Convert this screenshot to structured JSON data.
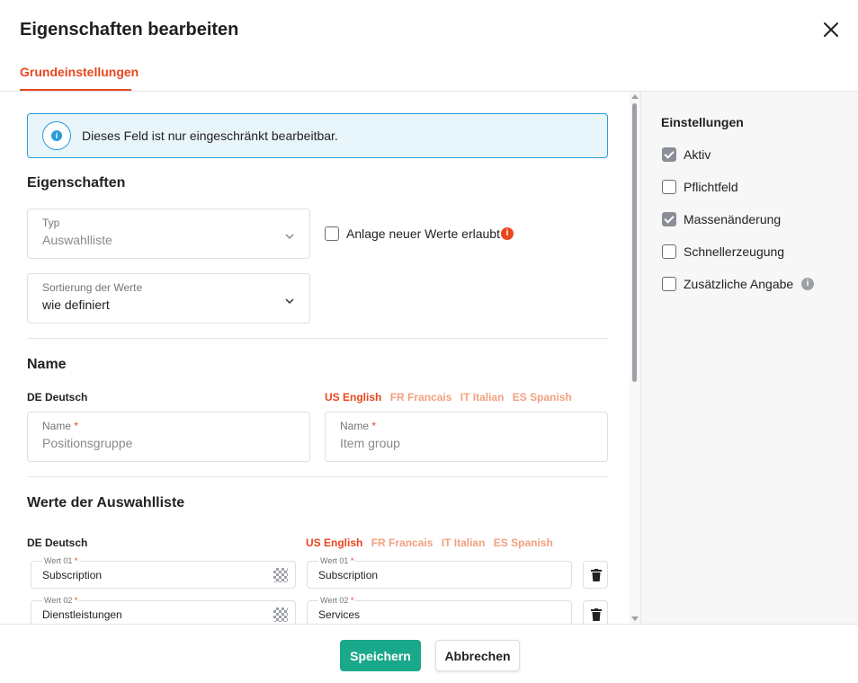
{
  "dialog": {
    "title": "Eigenschaften bearbeiten",
    "tab_label": "Grundeinstellungen"
  },
  "info": {
    "message": "Dieses Feld ist nur eingeschränkt bearbeitbar."
  },
  "properties": {
    "heading": "Eigenschaften",
    "type_label": "Typ",
    "type_value": "Auswahlliste",
    "allow_new_values_label": "Anlage neuer Werte erlaubt",
    "sort_label": "Sortierung der Werte",
    "sort_value": "wie definiert"
  },
  "name_section": {
    "heading": "Name",
    "de_lang": "DE Deutsch",
    "languages": [
      "US English",
      "FR Francais",
      "IT Italian",
      "ES Spanish"
    ],
    "de_field_label": "Name",
    "de_field_placeholder": "Positionsgruppe",
    "en_field_label": "Name",
    "en_field_placeholder": "Item group",
    "required_mark": "*"
  },
  "values_section": {
    "heading": "Werte der Auswahlliste",
    "de_lang": "DE Deutsch",
    "languages": [
      "US English",
      "FR Francais",
      "IT Italian",
      "ES Spanish"
    ],
    "rows": [
      {
        "label": "Wert 01",
        "de_value": "Subscription",
        "en_value": "Subscription"
      },
      {
        "label": "Wert 02",
        "de_value": "Dienstleistungen",
        "en_value": "Services"
      }
    ]
  },
  "settings": {
    "heading": "Einstellungen",
    "items": [
      {
        "label": "Aktiv",
        "checked": true
      },
      {
        "label": "Pflichtfeld",
        "checked": false
      },
      {
        "label": "Massenänderung",
        "checked": true
      },
      {
        "label": "Schnellerzeugung",
        "checked": false
      },
      {
        "label": "Zusätzliche Angabe",
        "checked": false
      }
    ]
  },
  "footer": {
    "save_label": "Speichern",
    "cancel_label": "Abbrechen"
  },
  "colors": {
    "accent": "#e8471e",
    "primary_button": "#1aa88a",
    "info_border": "#2a9bd7",
    "info_bg": "#e8f5fb"
  },
  "icons": {
    "close": "close-icon",
    "info": "info-icon",
    "chevron": "chevron-down-icon",
    "trash": "trash-icon",
    "translate": "checker-icon"
  }
}
